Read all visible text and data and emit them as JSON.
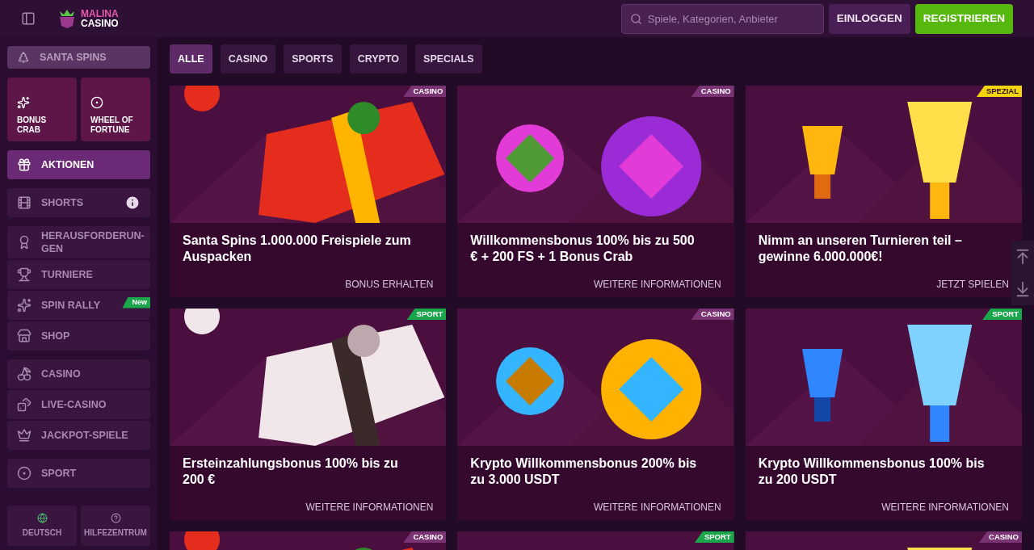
{
  "header": {
    "logo_top": "MALINA",
    "logo_bottom": "CASINO",
    "search": {
      "placeholder": "Spiele, Kategorien, Anbieter"
    },
    "buttons": [
      {
        "label": "EINLOGGEN",
        "kind": "secondary"
      },
      {
        "label": "REGISTRIEREN",
        "kind": "primary"
      }
    ]
  },
  "sidebar": {
    "featured": {
      "label": "SANTA SPINS"
    },
    "tiles": [
      {
        "label": "BONUS CRAB"
      },
      {
        "label": "WHEEL OF FORTUNE"
      }
    ],
    "groups": [
      [
        {
          "label": "AKTIONEN",
          "selected": true
        }
      ],
      [
        {
          "label": "SHORTS",
          "selected": false,
          "info": true
        }
      ],
      [
        {
          "label": "HERAUSFORDERUN-GEN",
          "selected": false
        },
        {
          "label": "TURNIERE",
          "selected": false
        },
        {
          "label": "SPIN RALLY",
          "selected": false,
          "badge": "New"
        },
        {
          "label": "SHOP",
          "selected": false
        }
      ],
      [
        {
          "label": "CASINO",
          "selected": false
        },
        {
          "label": "LIVE-CASINO",
          "selected": false
        },
        {
          "label": "JACKPOT-SPIELE",
          "selected": false
        }
      ],
      [
        {
          "label": "SPORT",
          "selected": false
        }
      ]
    ],
    "footer": [
      {
        "label": "DEUTSCH"
      },
      {
        "label": "HILFEZENTRUM"
      }
    ]
  },
  "tabs": [
    {
      "label": "ALLE",
      "selected": true
    },
    {
      "label": "CASINO",
      "selected": false
    },
    {
      "label": "SPORTS",
      "selected": false
    },
    {
      "label": "CRYPTO",
      "selected": false
    },
    {
      "label": "SPECIALS",
      "selected": false
    }
  ],
  "cards": [
    {
      "tag": {
        "label": "CASINO",
        "color": "#7a3474"
      },
      "title": "Santa Spins 1.000.000 Freispiele zum Auspacken",
      "link": "BONUS ERHALTEN"
    },
    {
      "tag": {
        "label": "CASINO",
        "color": "#7a3474"
      },
      "title": "Willkommensbonus 100% bis zu 500 € + 200 FS + 1 Bonus Crab",
      "link": "WEITERE INFORMATIONEN"
    },
    {
      "tag": {
        "label": "SPEZIAL",
        "color": "#f2d40f"
      },
      "title": "Nimm an unseren Turnieren teil – gewinne 6.000.000€!",
      "link": "JETZT SPIELEN"
    },
    {
      "tag": {
        "label": "SPORT",
        "color": "#1ca64c"
      },
      "title": "Ersteinzahlungsbonus 100% bis zu 200 €",
      "link": "WEITERE INFORMATIONEN"
    },
    {
      "tag": {
        "label": "CASINO",
        "color": "#7a3474"
      },
      "title": "Krypto Willkommensbonus 200% bis zu 3.000 USDT",
      "link": "WEITERE INFORMATIONEN"
    },
    {
      "tag": {
        "label": "SPORT",
        "color": "#1ca64c"
      },
      "title": "Krypto Willkommensbonus 100% bis zu 200 USDT",
      "link": "WEITERE INFORMATIONEN"
    },
    {
      "tag": {
        "label": "CASINO",
        "color": "#7a3474"
      }
    },
    {
      "tag": {
        "label": "SPORT",
        "color": "#1ca64c"
      }
    },
    {
      "tag": {
        "label": "CASINO",
        "color": "#7a3474"
      }
    }
  ]
}
